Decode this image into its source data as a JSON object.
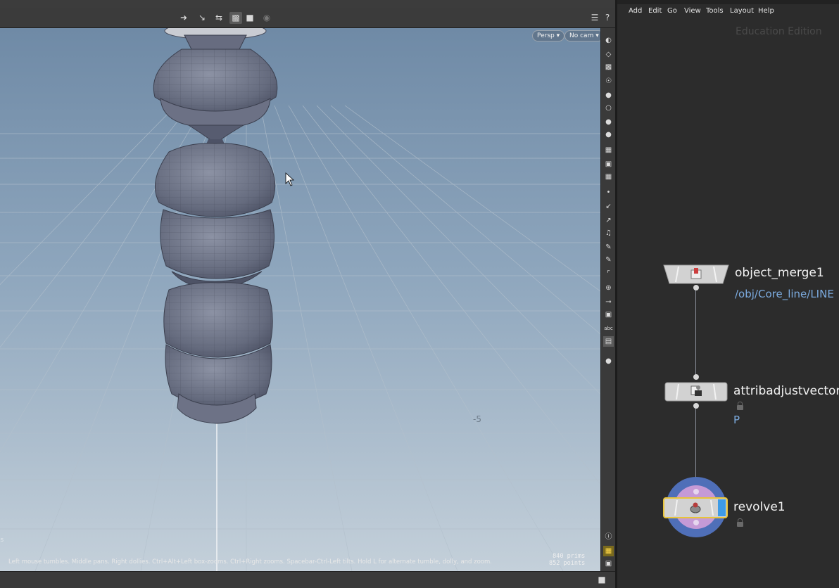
{
  "viewport": {
    "camera_pill": "Persp",
    "cam_pill": "No cam",
    "status_hint": "Left mouse tumbles. Middle pans. Right dollies. Ctrl+Alt+Left box-zooms. Ctrl+Right zooms. Spacebar-Ctrl-Left tilts. Hold L for alternate tumble, dolly, and zoom.",
    "prims_count": "840",
    "prims_label": "prims",
    "points_count": "852",
    "points_label": "points",
    "grid_label": "-5",
    "left_edge_label": "is",
    "right_tool_abc": "abc"
  },
  "network": {
    "menu": [
      "Add",
      "Edit",
      "Go",
      "View",
      "Tools",
      "Layout",
      "Help"
    ],
    "watermark": "Education Edition",
    "nodes": [
      {
        "name": "object_merge1",
        "param": "/obj/Core_line/LINE"
      },
      {
        "name": "attribadjustvector",
        "param": "P"
      },
      {
        "name": "revolve1",
        "param": ""
      }
    ]
  },
  "colors": {
    "param_text": "#7cabdf",
    "selected_outline": "#e8c43a",
    "display_flag": "#3e9be6",
    "render_ring": "#4f6fb8",
    "template_ring": "#c59ad6"
  }
}
